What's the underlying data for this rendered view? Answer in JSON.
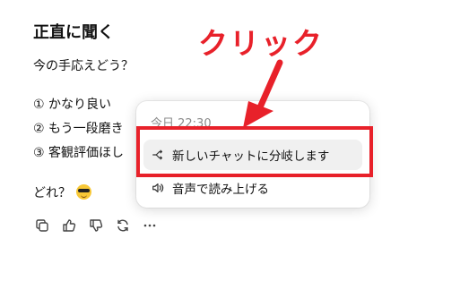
{
  "message": {
    "title": "正直に聞く",
    "intro": "今の手応えどう？",
    "options": [
      "① かなり良い",
      "② もう一段磨き",
      "③ 客観評価ほし"
    ],
    "question": "どれ？",
    "emoji_icon": "sunglasses-face-emoji"
  },
  "actions": [
    {
      "name": "copy-icon"
    },
    {
      "name": "thumbs-up-icon"
    },
    {
      "name": "thumbs-down-icon"
    },
    {
      "name": "retry-icon"
    },
    {
      "name": "more-icon"
    }
  ],
  "menu": {
    "timestamp": "今日 22:30",
    "items": [
      {
        "label": "新しいチャットに分岐します",
        "icon": "branch-icon"
      },
      {
        "label": "音声で読み上げる",
        "icon": "speaker-icon"
      }
    ]
  },
  "annotation": {
    "text": "クリック",
    "color": "#e8212a"
  }
}
